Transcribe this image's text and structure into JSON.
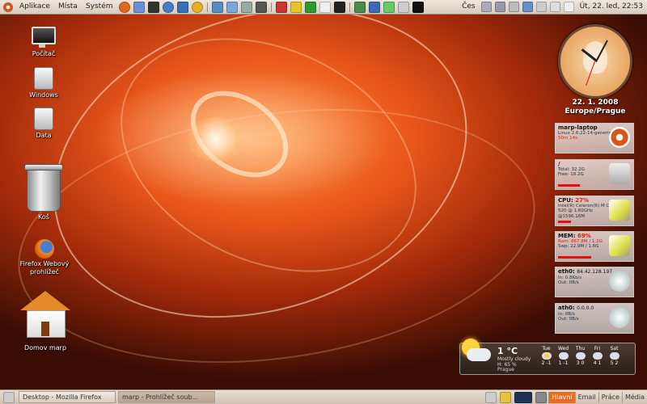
{
  "top_panel": {
    "menus": [
      "Aplikace",
      "Místa",
      "Systém"
    ],
    "keyboard_layout": "Čes",
    "clock": "Út, 22. led, 22:53",
    "launcher_icons": [
      "firefox-icon",
      "mail-icon",
      "terminal-icon",
      "network-icon",
      "web-icon",
      "chat-icon",
      "media-icon",
      "calendar-icon",
      "disk-icon",
      "music-icon",
      "play-icon",
      "pause-icon",
      "clock-icon",
      "film-icon",
      "text-icon",
      "image-icon",
      "monitor-icon",
      "settings-icon"
    ]
  },
  "desktop_icons": {
    "computer": "Počítač",
    "windows": "Windows",
    "data": "Data",
    "trash": "Koš",
    "firefox": "Firefox Webový prohlížeč",
    "home": "Domov marp"
  },
  "clock_widget": {
    "date": "22. 1. 2008",
    "timezone": "Europe/Prague"
  },
  "conky": {
    "system": {
      "title": "marp-laptop",
      "line1": "Linux  2.6.22-14-generic",
      "line2": "50m 14s"
    },
    "disk": {
      "title": "/",
      "line1": "Total: 32.2G",
      "line2": "Free: 18.2G",
      "usage_fraction": 0.45
    },
    "cpu": {
      "title": "CPU:",
      "value": "27%",
      "line1": "Intel(R) Celeron(R) M CPU",
      "line2": "520 @ 1.60GHz",
      "line3": "@1596.16M",
      "usage_fraction": 0.27
    },
    "mem": {
      "title": "MEM:",
      "value": "69%",
      "line1": "Ram: 867.8M / 1.2G",
      "line2": "Swp: 22.9M / 1.6G",
      "usage_fraction": 0.69
    },
    "eth0": {
      "title": "eth0:",
      "ip": "84.42.128.197",
      "line1": "In:  0.8Kb/s",
      "line2": "Out:  0B/s"
    },
    "ath0": {
      "title": "ath0:",
      "ip": "0.0.0.0",
      "line1": "In:  0B/s",
      "line2": "Out:  0B/s"
    }
  },
  "weather": {
    "temp": "1 °C",
    "condition": "Mostly cloudy",
    "humidity": "H: 65 %",
    "city": "Prague",
    "forecast": [
      {
        "day": "Tue",
        "range": "2 -1"
      },
      {
        "day": "Wed",
        "range": "1 -1"
      },
      {
        "day": "Thu",
        "range": "3 0"
      },
      {
        "day": "Fri",
        "range": "4 1"
      },
      {
        "day": "Sat",
        "range": "5 2"
      }
    ]
  },
  "bottom_panel": {
    "tasks": [
      "Desktop - Mozilla Firefox",
      "marp - Prohlížeč soub..."
    ],
    "workspaces": [
      "Hlavní",
      "Email",
      "Práce",
      "Média"
    ],
    "active_workspace": "Hlavní"
  }
}
